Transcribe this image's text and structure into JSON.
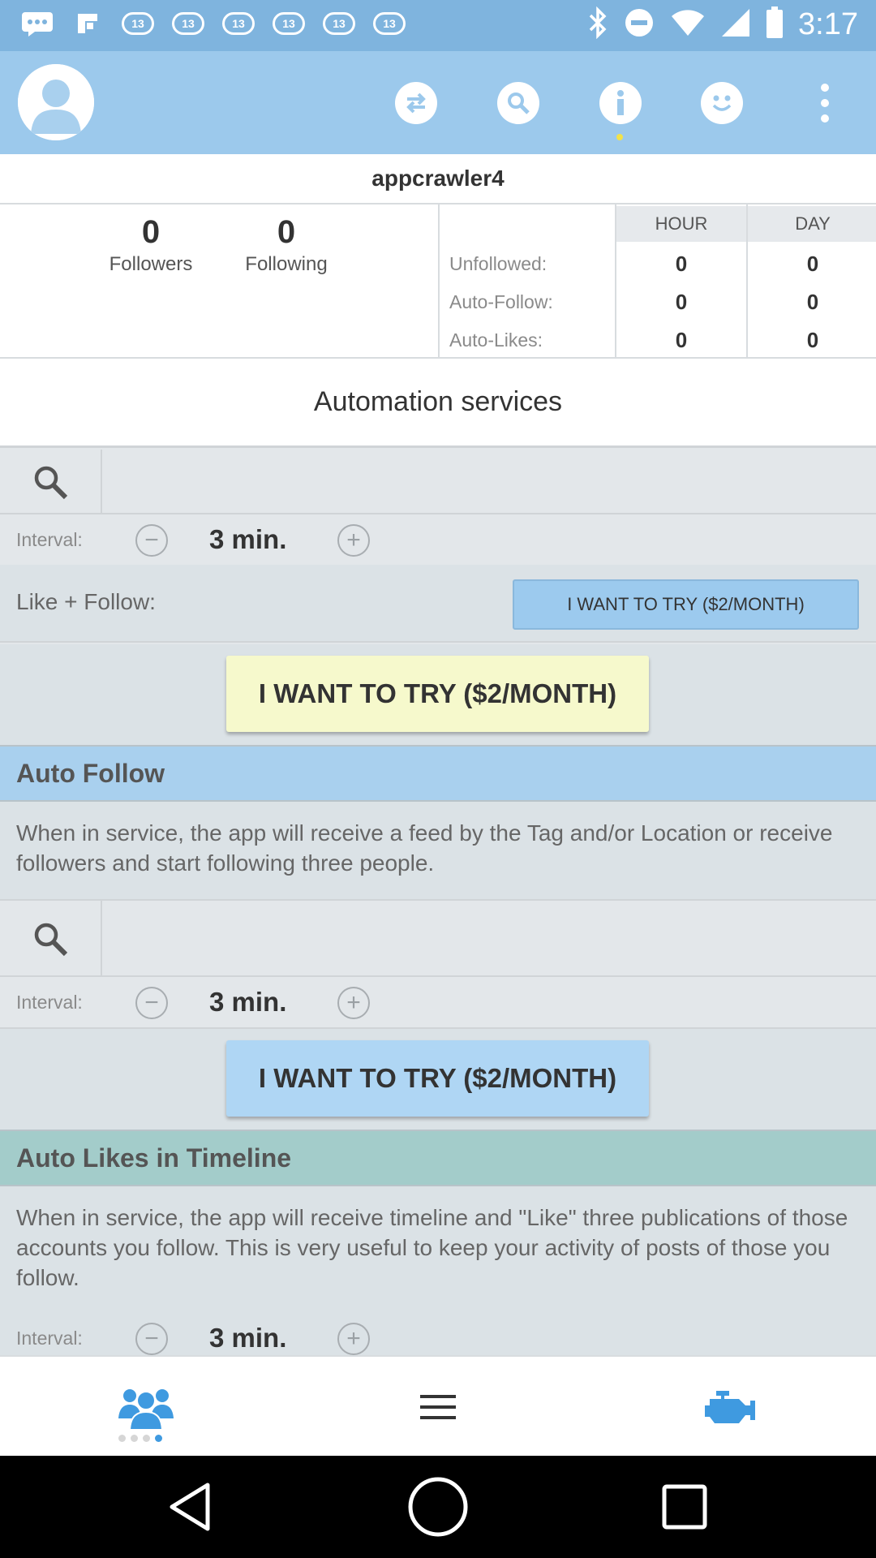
{
  "status_bar": {
    "time": "3:17",
    "notification_badge": "13",
    "icons": [
      "message-icon",
      "flipboard-icon",
      "abc13-icon",
      "abc13-icon",
      "abc13-icon",
      "abc13-icon",
      "abc13-icon",
      "abc13-icon",
      "bluetooth-icon",
      "do-not-disturb-icon",
      "wifi-icon",
      "signal-icon",
      "battery-icon"
    ]
  },
  "app_bar": {
    "icons": [
      "avatar-icon",
      "switch-icon",
      "search-icon",
      "info-icon",
      "smiley-icon",
      "more-vert-icon"
    ],
    "active_icon": "info-icon"
  },
  "profile": {
    "username": "appcrawler4",
    "followers_count": "0",
    "followers_label": "Followers",
    "following_count": "0",
    "following_label": "Following"
  },
  "stats_table": {
    "columns": [
      "HOUR",
      "DAY"
    ],
    "rows": [
      {
        "label": "Unfollowed:",
        "hour": "0",
        "day": "0"
      },
      {
        "label": "Auto-Follow:",
        "hour": "0",
        "day": "0"
      },
      {
        "label": "Auto-Likes:",
        "hour": "0",
        "day": "0"
      }
    ]
  },
  "automation": {
    "title": "Automation services",
    "search": {
      "value": "",
      "placeholder": ""
    },
    "interval_label": "Interval:",
    "interval_value": "3 min.",
    "like_follow_label": "Like + Follow:",
    "try_label": "I WANT TO TRY ($2/MONTH)"
  },
  "auto_follow": {
    "title": "Auto Follow",
    "description": "When in service, the app will receive a feed by the Tag and/or Location or receive followers and start following three people.",
    "search": {
      "value": "",
      "placeholder": ""
    },
    "interval_label": "Interval:",
    "interval_value": "3 min.",
    "try_label": "I WANT TO TRY ($2/MONTH)"
  },
  "auto_likes": {
    "title": "Auto Likes in Timeline",
    "description": "When in service, the app will receive timeline and \"Like\" three publications of those accounts you follow. This is very useful to keep your activity of posts of those you follow.",
    "interval_label": "Interval:",
    "interval_value": "3 min."
  },
  "bottom_nav": {
    "items": [
      "people-icon",
      "menu-icon",
      "engine-icon"
    ]
  },
  "system_nav": {
    "items": [
      "back-icon",
      "home-icon",
      "recents-icon"
    ]
  },
  "colors": {
    "status_bar": "#7fb4de",
    "app_bar": "#9cc9ec",
    "section_blue": "#a9d0ee",
    "section_teal": "#a3ccca",
    "try_yellow": "#f6f9cc",
    "try_blue": "#afd6f4"
  }
}
